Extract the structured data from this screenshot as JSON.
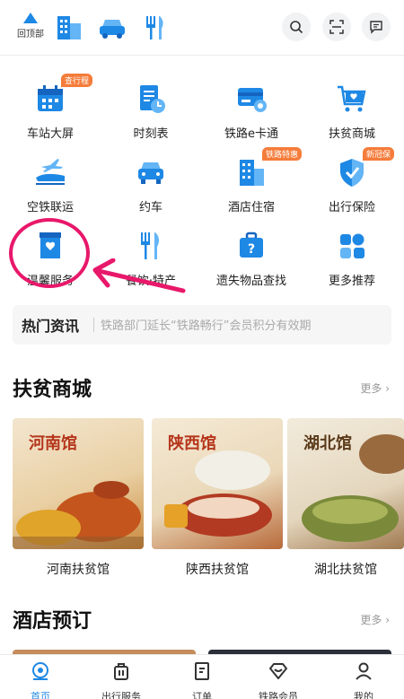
{
  "topbar": {
    "back_to_top_label": "回顶部",
    "icons": [
      "building-icon",
      "car-icon",
      "dining-icon"
    ],
    "search_icon": "search-icon",
    "scan_icon": "scan-icon",
    "message_icon": "message-icon"
  },
  "services": [
    {
      "label": "车站大屏",
      "icon": "calendar-icon",
      "tag": "查行程"
    },
    {
      "label": "时刻表",
      "icon": "timetable-icon",
      "tag": ""
    },
    {
      "label": "铁路e卡通",
      "icon": "ecard-icon",
      "tag": ""
    },
    {
      "label": "扶贫商城",
      "icon": "cart-icon",
      "tag": ""
    },
    {
      "label": "空铁联运",
      "icon": "train-plane-icon",
      "tag": ""
    },
    {
      "label": "约车",
      "icon": "car-icon",
      "tag": ""
    },
    {
      "label": "酒店住宿",
      "icon": "hotel-icon",
      "tag": "铁路特惠"
    },
    {
      "label": "出行保险",
      "icon": "shield-icon",
      "tag": "新冠保"
    },
    {
      "label": "温馨服务",
      "icon": "heart-service-icon",
      "tag": ""
    },
    {
      "label": "餐饮·特产",
      "icon": "dining-icon",
      "tag": ""
    },
    {
      "label": "遗失物品查找",
      "icon": "lost-item-icon",
      "tag": ""
    },
    {
      "label": "更多推荐",
      "icon": "more-grid-icon",
      "tag": ""
    }
  ],
  "news": {
    "brand": "热门资讯",
    "headline": "铁路部门延长“铁路畅行”会员积分有效期"
  },
  "shop": {
    "title": "扶贫商城",
    "more": "更多",
    "cards": [
      {
        "banner": "河南馆",
        "label": "河南扶贫馆"
      },
      {
        "banner": "陕西馆",
        "label": "陕西扶贫馆"
      },
      {
        "banner": "湖北馆",
        "label": "湖北扶贫馆"
      }
    ]
  },
  "hotel": {
    "title": "酒店预订",
    "more": "更多"
  },
  "bottom_nav": [
    {
      "label": "首页",
      "icon": "home-icon",
      "active": true
    },
    {
      "label": "出行服务",
      "icon": "luggage-icon",
      "active": false
    },
    {
      "label": "订单",
      "icon": "order-icon",
      "active": false
    },
    {
      "label": "铁路会员",
      "icon": "member-icon",
      "active": false
    },
    {
      "label": "我的",
      "icon": "profile-icon",
      "active": false
    }
  ],
  "colors": {
    "primary_blue": "#1e88e5",
    "accent_orange": "#f57c3a",
    "highlight_pink": "#e8186a"
  }
}
